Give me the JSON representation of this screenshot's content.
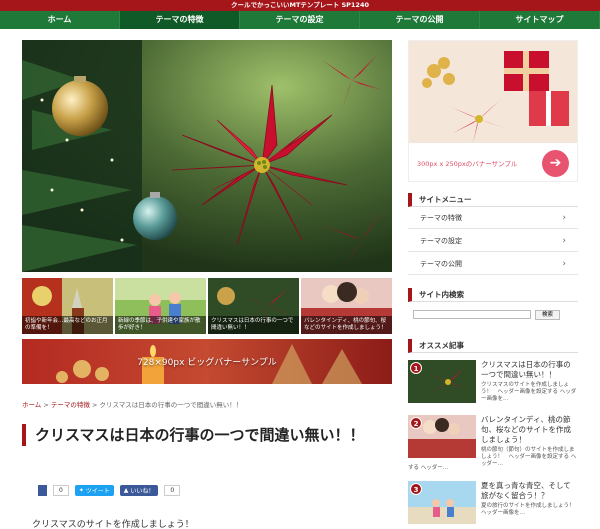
{
  "topbar": {
    "title": "クールでかっこいいMTテンプレート SP1240"
  },
  "nav": {
    "items": [
      {
        "label": "ホーム"
      },
      {
        "label": "テーマの特徴",
        "active": true
      },
      {
        "label": "テーマの設定"
      },
      {
        "label": "テーマの公開"
      },
      {
        "label": "サイトマップ"
      }
    ]
  },
  "thumbs": [
    {
      "caption": "初詣や新年会…最高などのお正月の準備を！"
    },
    {
      "caption": "新緑の季節は、子供達や家族が散歩が好き！"
    },
    {
      "caption": "クリスマスは日本の行事の一つで間違い無い！！"
    },
    {
      "caption": "バレンタインディ、桃の節句、桜などのサイトを作成しましょう！"
    }
  ],
  "banner_big": {
    "label": "728×90px ビッグバナーサンプル"
  },
  "breadcrumb": {
    "home": "ホーム",
    "sep1": " > ",
    "category": "テーマの特徴",
    "sep2": " > ",
    "current": "クリスマスは日本の行事の一つで間違い無い！！"
  },
  "article": {
    "title": "クリスマスは日本の行事の一つで間違い無い！！",
    "intro": "クリスマスのサイトを作成しましょう！"
  },
  "share": {
    "fb_count": "0",
    "tweet": "ツイート",
    "like": "いいね！",
    "like_count": "0"
  },
  "sidebar": {
    "banner_text": "300px x 250pxのバナーサンプル",
    "banner_arrow": "➔",
    "menu_title": "サイトメニュー",
    "menu_items": [
      {
        "label": "テーマの特徴"
      },
      {
        "label": "テーマの設定"
      },
      {
        "label": "テーマの公開"
      }
    ],
    "chevron": "›",
    "search_title": "サイト内検索",
    "search_button": "検索",
    "recommend_title": "オススメ記事",
    "recommend": [
      {
        "num": "1",
        "title": "クリスマスは日本の行事の一つで間違い無い！！",
        "excerpt": "クリスマスのサイトを作成しましょう！　ヘッダー画像を設定する ヘッダー画像を…"
      },
      {
        "num": "2",
        "title": "バレンタインディ、桃の節句、桜などのサイトを作成しましょう！",
        "excerpt": "桃の節句（節句）のサイトを作成しましょう！　ヘッダー画像を設定する ヘッダー…",
        "excerpt2": "する ヘッダー…"
      },
      {
        "num": "3",
        "title": "夏を真っ青な青空、そして旅がなく留合う！？",
        "excerpt": "夏の旅行のサイトを作成しましょう！　ヘッダー画像を…"
      }
    ]
  },
  "colors": {
    "brand_red": "#a4161a",
    "nav_green": "#1f7a3a",
    "pink": "#e85470"
  }
}
